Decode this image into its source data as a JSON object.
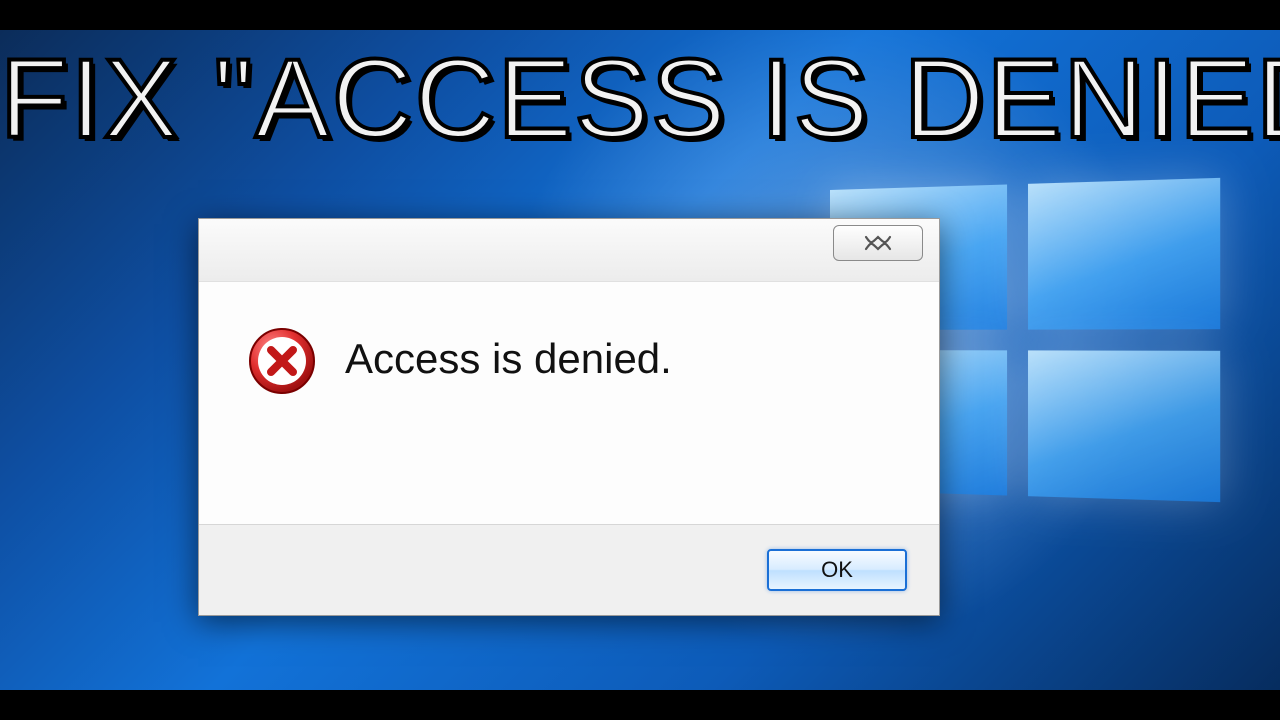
{
  "headline": "FIX \"ACCESS IS DENIED\"",
  "dialog": {
    "message": "Access is denied.",
    "ok_label": "OK"
  }
}
